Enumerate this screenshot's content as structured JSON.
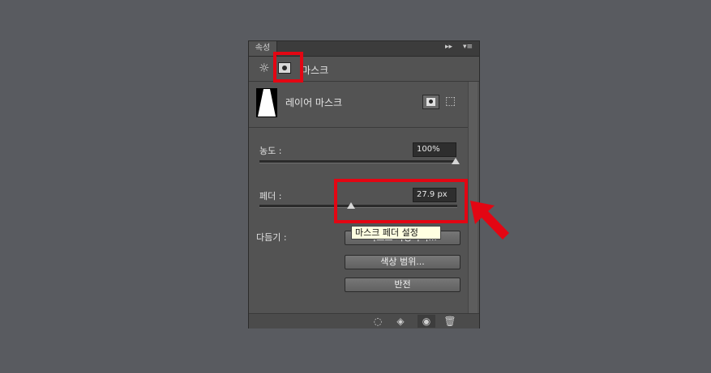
{
  "panel": {
    "tab_label": "속성",
    "collapse_glyph": "▸▸",
    "menu_glyph": "▾≡",
    "header_title": "마스크",
    "layer_mask_label": "레이어 마스크",
    "density": {
      "label": "농도 :",
      "value": "100%",
      "level_percent": 100
    },
    "feather": {
      "label": "페더 :",
      "value": "27.9 px",
      "level_percent": 46
    },
    "refine_label": "다듬기 :",
    "buttons": {
      "mask_edge": "마스크 가장자리...",
      "color_range": "색상 범위...",
      "invert": "반전"
    },
    "tooltip": "마스크 페더 설정",
    "icons": {
      "adjust": "sun-icon",
      "mask": "mask-icon",
      "pixel_mask": "pixel-mask-icon",
      "vector_mask": "vector-mask-icon",
      "selection": "dotted-circle-icon",
      "apply": "apply-mask-icon",
      "visibility": "eye-icon",
      "delete": "trash-icon"
    },
    "highlight_color": "#e30613"
  }
}
